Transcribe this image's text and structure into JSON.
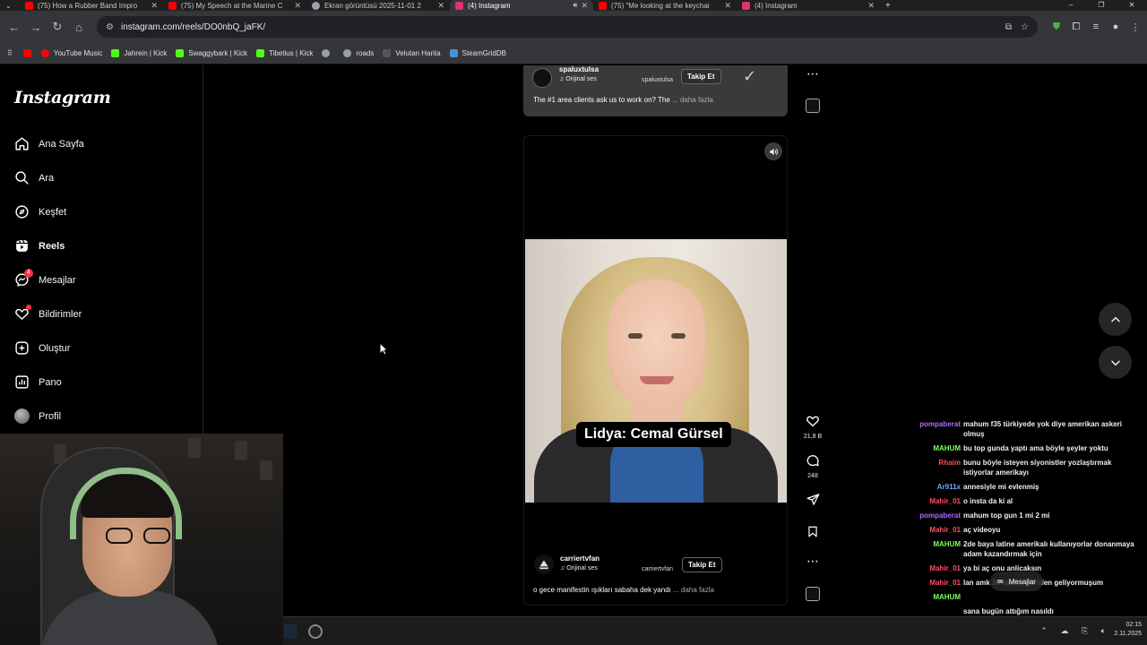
{
  "browser": {
    "tabs": [
      {
        "title": "(75) How a Rubber Band Impro",
        "favicon_color": "#ff0000"
      },
      {
        "title": "(75) My Speech at the Marine C",
        "favicon_color": "#ff0000"
      },
      {
        "title": "Ekran görüntüsü 2025-11-01 2",
        "favicon_color": "#9aa0a6"
      },
      {
        "title": "(4) Instagram",
        "favicon_color": "#e1306c",
        "active": true,
        "playing_audio": true
      },
      {
        "title": "(75) \"Me looking at the keychai",
        "favicon_color": "#ff0000"
      },
      {
        "title": "(4) Instagram",
        "favicon_color": "#e1306c"
      }
    ],
    "new_tab_glyph": "+",
    "address": "instagram.com/reels/DO0nbQ_jaFK/",
    "bookmarks": [
      {
        "label": "YouTube Music",
        "icon_color": "#ff0000"
      },
      {
        "label": "Jahrein | Kick",
        "icon_color": "#53fc18"
      },
      {
        "label": "Swaggybark | Kick",
        "icon_color": "#53fc18"
      },
      {
        "label": "Tibetius | Kick",
        "icon_color": "#53fc18"
      },
      {
        "label": "",
        "icon_color": "#9aa0a6"
      },
      {
        "label": "roads",
        "icon_color": "#9aa0a6"
      },
      {
        "label": "Velutan Harita",
        "icon_color": "#555555"
      },
      {
        "label": "SteamGridDB",
        "icon_color": "#4a90d9"
      }
    ]
  },
  "sidebar": {
    "logo": "Instagram",
    "items": [
      {
        "label": "Ana Sayfa",
        "icon": "home-icon"
      },
      {
        "label": "Ara",
        "icon": "search-icon"
      },
      {
        "label": "Keşfet",
        "icon": "explore-icon"
      },
      {
        "label": "Reels",
        "icon": "reels-icon",
        "active": true
      },
      {
        "label": "Mesajlar",
        "icon": "messenger-icon",
        "badge": "4"
      },
      {
        "label": "Bildirimler",
        "icon": "heart-icon"
      },
      {
        "label": "Oluştur",
        "icon": "plus-square-icon"
      },
      {
        "label": "Pano",
        "icon": "dashboard-icon"
      },
      {
        "label": "Profil",
        "icon": "avatar"
      }
    ]
  },
  "reel_previous": {
    "username": "spaluxtulsa",
    "audio": "Orijinal ses",
    "creator": "spaluxtulsa",
    "follow": "Takip Et",
    "caption": "The #1 area clients ask us to work on? The",
    "more": "... daha fazla"
  },
  "reel_current": {
    "overlay_caption": "Lidya: Cemal Gürsel",
    "username": "carriertvfan",
    "audio": "Orijinal ses",
    "creator": "carriertvfan",
    "follow": "Takip Et",
    "caption": "o gece manifestin ışıkları sabaha dek yandı",
    "more": "... daha fazla"
  },
  "actions": {
    "likes": "21,8 B",
    "comments": "248"
  },
  "chat": [
    {
      "user": "pompaberat",
      "color": "#b26bff",
      "text": "mahum f35 türkiyede yok diye amerikan askeri olmuş"
    },
    {
      "user": "MAHUM",
      "color": "#7cff5a",
      "text": "bu top gunda yaptı ama böyle şeyler yoktu"
    },
    {
      "user": "Rhaim",
      "color": "#ff4d4d",
      "text": "bunu böyle isteyen siyonistler yozlaştırmak istiyorlar amerikayı"
    },
    {
      "user": "Ar911x",
      "color": "#6aa7ff",
      "text": "annesiyle mi evlenmiş"
    },
    {
      "user": "Mahir_01",
      "color": "#ff4d6a",
      "text": "o insta da ki al"
    },
    {
      "user": "pompaberat",
      "color": "#b26bff",
      "text": "mahum top gun 1 mi 2 mi"
    },
    {
      "user": "Mahir_01",
      "color": "#ff4d6a",
      "text": "aç videoyu"
    },
    {
      "user": "MAHUM",
      "color": "#7cff5a",
      "text": "2de baya latine amerikalı kullanıyorlar donanmaya adam kazandırmak için"
    },
    {
      "user": "Mahir_01",
      "color": "#ff4d6a",
      "text": "ya bi aç onu anlicaksın"
    },
    {
      "user": "Mahir_01",
      "color": "#ff4d6a",
      "text": "lan amk 30 saniye geriden geliyormuşum"
    },
    {
      "user": "MAHUM",
      "color": "#7cff5a",
      "text": ""
    },
    {
      "user": "",
      "color": "#ffffff",
      "text": "sana bugün attığım nasıldı"
    }
  ],
  "floating_messages": "Mesajlar",
  "tray": {
    "time": "02:15",
    "date": "2.11.2025"
  }
}
